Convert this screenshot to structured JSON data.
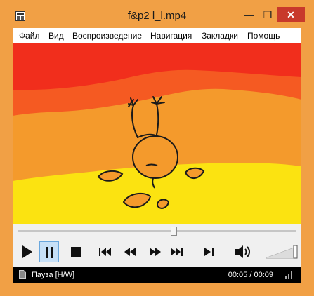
{
  "window": {
    "title": "f&p2 l_l.mp4",
    "min_icon": "minimize-icon",
    "max_icon": "maximize-icon",
    "close_icon": "close-icon",
    "min_glyph": "—",
    "max_glyph": "❐",
    "close_glyph": "✕"
  },
  "menu": [
    "Файл",
    "Вид",
    "Воспроизведение",
    "Навигация",
    "Закладки",
    "Помощь"
  ],
  "playback": {
    "seek_progress": 0.56,
    "volume_level": 1.0,
    "buttons": [
      "play",
      "pause",
      "stop",
      "previous",
      "rewind",
      "fast-forward",
      "next",
      "frame-step",
      "volume"
    ]
  },
  "status": {
    "text": "Пауза [H/W]",
    "time": "00:05 / 00:09"
  },
  "colors": {
    "frame": "#f1a045",
    "active_button": "#c7e0f7",
    "status_bar": "#000000"
  }
}
